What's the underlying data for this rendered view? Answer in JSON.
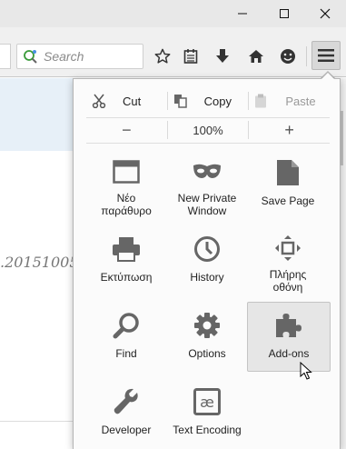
{
  "search": {
    "placeholder": "Search"
  },
  "edit": {
    "cut": "Cut",
    "copy": "Copy",
    "paste": "Paste"
  },
  "zoom": {
    "minus": "−",
    "level": "100%",
    "plus": "+"
  },
  "background": {
    "snippet": ".20151005"
  },
  "items": [
    {
      "label": "Νέο\nπαράθυρο",
      "icon": "new-window-icon"
    },
    {
      "label": "New Private\nWindow",
      "icon": "private-mask-icon"
    },
    {
      "label": "Save Page",
      "icon": "save-page-icon"
    },
    {
      "label": "Εκτύπωση",
      "icon": "print-icon"
    },
    {
      "label": "History",
      "icon": "history-clock-icon"
    },
    {
      "label": "Πλήρης\nοθόνη",
      "icon": "fullscreen-icon"
    },
    {
      "label": "Find",
      "icon": "magnifier-icon"
    },
    {
      "label": "Options",
      "icon": "gear-icon"
    },
    {
      "label": "Add-ons",
      "icon": "puzzle-piece-icon"
    },
    {
      "label": "Developer",
      "icon": "wrench-icon"
    },
    {
      "label": "Text Encoding",
      "icon": "ae-encoding-icon"
    }
  ],
  "colors": {
    "icon_gray": "#666666",
    "hover_bg": "#e6e6e6",
    "panel_bg": "#fbfbfb"
  }
}
